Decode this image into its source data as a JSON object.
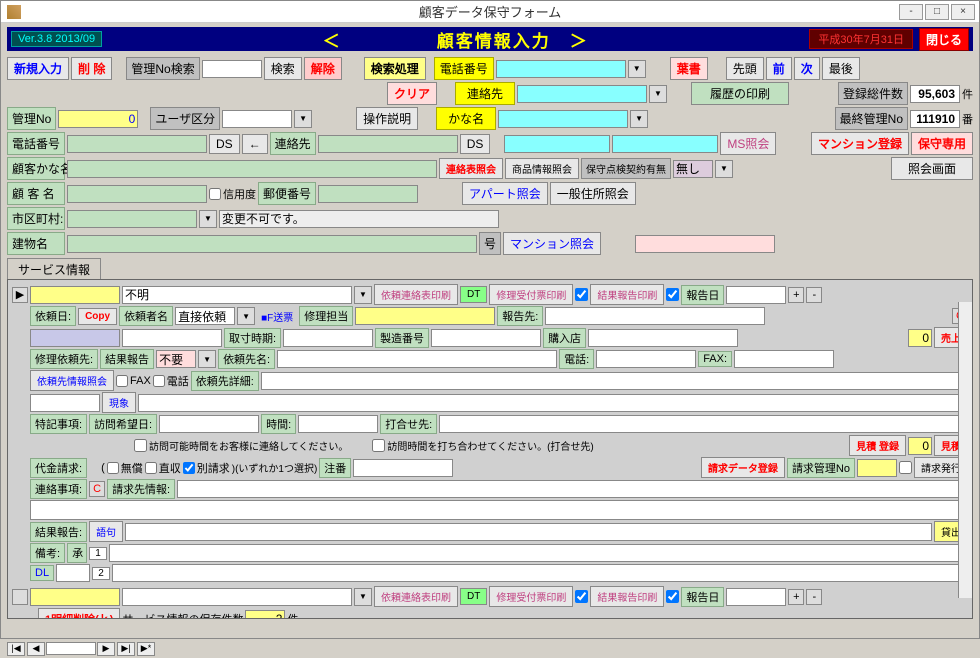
{
  "titlebar": {
    "title": "顧客データ保守フォーム",
    "min": "-",
    "max": "□",
    "close": "×"
  },
  "top": {
    "version": "Ver.3.8    2013/09",
    "app_title": "＜　　　　　顧客情報入力　＞",
    "date": "平成30年7月31日",
    "close": "閉じる"
  },
  "toolbar": {
    "new": "新規入力",
    "delete": "削 除",
    "mgmt_search": "管理No検索",
    "search": "検索",
    "clear_search": "解除",
    "search_proc": "検索処理",
    "clear": "クリア",
    "ops": "操作説明",
    "phone": "電話番号",
    "contact2": "連絡先",
    "kana2": "かな名",
    "book": "葉書",
    "first": "先頭",
    "prev": "前",
    "next": "次",
    "last": "最後",
    "hist": "履歴の印刷",
    "reg_total": "登録総件数",
    "reg_total_v": "95,603",
    "ken": "件",
    "last_mgmt": "最終管理No",
    "last_mgmt_v": "111910",
    "ban": "番"
  },
  "cust": {
    "mgmt_no": "管理No",
    "mgmt_no_v": "0",
    "user_cls": "ユーザ区分",
    "phone": "電話番号",
    "ds": "DS",
    "arrow": "←",
    "contact": "連絡先",
    "ms_inq": "MS照会",
    "ms_reg": "マンション登録",
    "maint": "保守専用",
    "kana": "顧客かな名",
    "contact_inq": "連絡表照会",
    "prod_inq": "商品情報照会",
    "maint_contract": "保守点検契約有無",
    "none": "無し",
    "inq_screen": "照会画面",
    "name": "顧 客 名",
    "credit": "信用度",
    "postal": "郵便番号",
    "apart_inq": "アパート照会",
    "addr_inq": "一般住所照会",
    "city": "市区町村:",
    "no_change": "変更不可です。",
    "bldg": "建物名",
    "go": "号",
    "mansion_inq": "マンション照会"
  },
  "serv": {
    "tab": "サービス情報",
    "unknown": "不明",
    "req_print": "依頼連絡表印刷",
    "dt": "DT",
    "recv_print": "修理受付票印刷",
    "result_print": "結果報告印刷",
    "rep_date": "報告日",
    "req_date": "依頼日:",
    "copy": "Copy",
    "req_name": "依頼者名",
    "direct": "直接依頼",
    "fbox": "■F送票",
    "rep_tanto": "修理担当",
    "rep_to": "報告先:",
    "c": "C",
    "acq": "取寸時期:",
    "serial": "製造番号",
    "store": "購入店",
    "zero": "0",
    "sales": "売上",
    "repair_to": "修理依頼先:",
    "result": "結果報告",
    "fuyou": "不要",
    "req_name2": "依頼先名:",
    "tel": "電話:",
    "fax_l": "FAX:",
    "fax": "FAX",
    "tel2": "電話",
    "req_detail": "依頼先詳細:",
    "req_info": "依頼先情報照会",
    "genba": "現象",
    "special": "特記事項:",
    "visit": "訪問希望日:",
    "time": "時間:",
    "meet": "打合せ先:",
    "note1": "訪問可能時間をお客様に連絡してください。",
    "note2": "訪問時間を打ち合わせてください。(打合せ先)",
    "est_reg": "見積 登録",
    "est": "見積",
    "bill": "代金請求:",
    "free": "無償",
    "direct2": "直収",
    "betsu": "別請求",
    "choice": ")(いずれか1つ選択)",
    "chumon": "注番",
    "bill_data": "請求データ登録",
    "bill_mgmt": "請求管理No",
    "bill_issue": "請求発行",
    "contact_item": "連絡事項:",
    "bill_info": "請求先情報:",
    "result2": "結果報告:",
    "goku": "語句",
    "kashidashi": "貸出",
    "remark": "備考:",
    "sho": "承",
    "one": "1",
    "two": "2",
    "dl": "DL",
    "rec_del": "1明細削除(ｋ)",
    "save_count": "サービス情報の保存件数",
    "save_v": "2",
    "ken": "件"
  }
}
